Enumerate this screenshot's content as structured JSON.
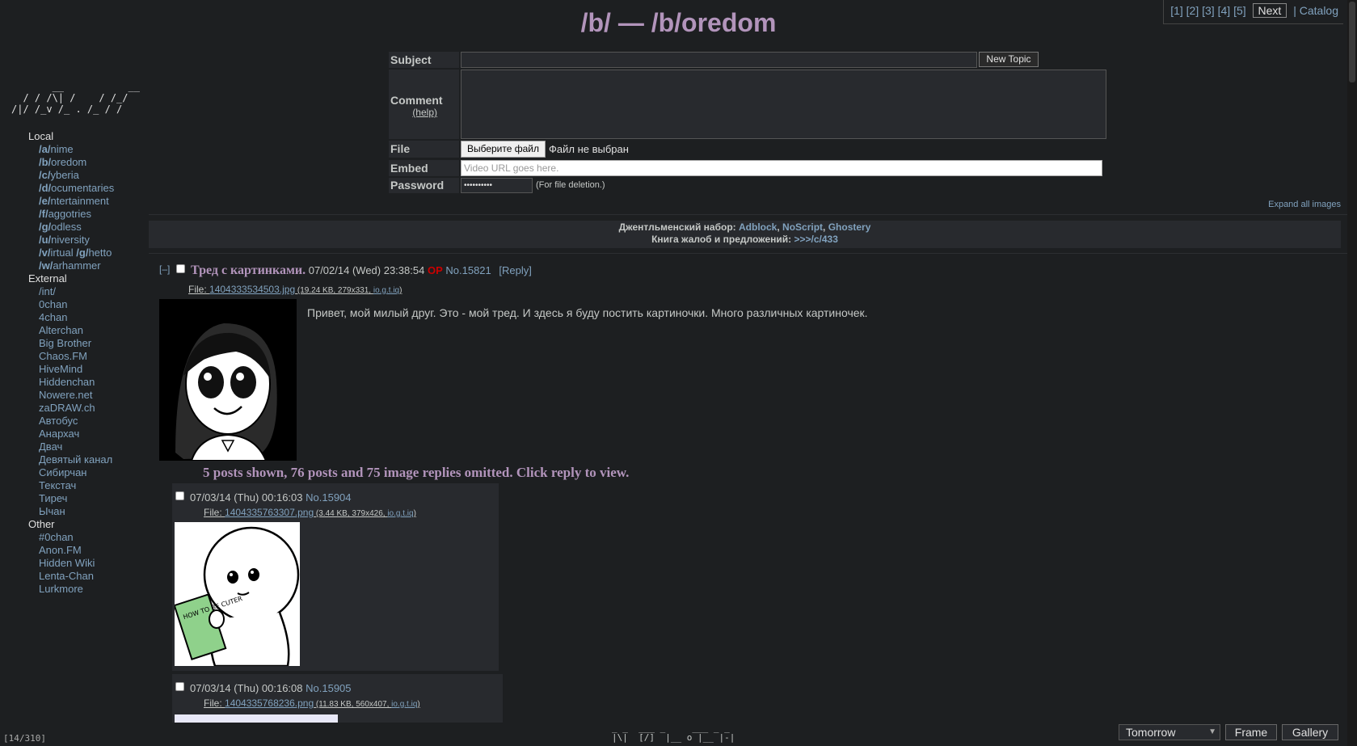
{
  "board_title": "/b/ — /b/oredom",
  "pager": {
    "pages": [
      "[1]",
      "[2]",
      "[3]",
      "[4]",
      "[5]"
    ],
    "next_label": "Next",
    "catalog_label": "| Catalog"
  },
  "sidebar": {
    "ascii_logo": "       __           __\n  / / /\\| /    / /_/\n/|/ /_v /_ . /_ / /",
    "sections": [
      {
        "label": "Local",
        "items": [
          {
            "bold": "/a/",
            "rest": "nime"
          },
          {
            "bold": "/b/",
            "rest": "oredom"
          },
          {
            "bold": "/c/",
            "rest": "yberia"
          },
          {
            "bold": "/d/",
            "rest": "ocumentaries"
          },
          {
            "bold": "/e/",
            "rest": "ntertainment"
          },
          {
            "bold": "/f/",
            "rest": "aggotries"
          },
          {
            "bold": "/g/",
            "rest": "odless"
          },
          {
            "bold": "/u/",
            "rest": "niversity"
          },
          {
            "bold": "/v/",
            "rest": "irtual ",
            "bold2": "/g/",
            "rest2": "hetto"
          },
          {
            "bold": "/w/",
            "rest": "arhammer"
          }
        ]
      },
      {
        "label": "External",
        "items": [
          {
            "rest": "/int/"
          },
          {
            "rest": "0chan"
          },
          {
            "rest": "4chan"
          },
          {
            "rest": "Alterchan"
          },
          {
            "rest": "Big Brother"
          },
          {
            "rest": "Chaos.FM"
          },
          {
            "rest": "HiveMind"
          },
          {
            "rest": "Hiddenchan"
          },
          {
            "rest": "Nowere.net"
          },
          {
            "rest": "zaDRAW.ch"
          },
          {
            "rest": "Автобус"
          },
          {
            "rest": "Анархач"
          },
          {
            "rest": "Двач"
          },
          {
            "rest": "Девятый канал"
          },
          {
            "rest": "Сибирчан"
          },
          {
            "rest": "Текстач"
          },
          {
            "rest": "Тиреч"
          },
          {
            "rest": "Ычан"
          }
        ]
      },
      {
        "label": "Other",
        "items": [
          {
            "rest": "#0chan"
          },
          {
            "rest": "Anon.FM"
          },
          {
            "rest": "Hidden Wiki"
          },
          {
            "rest": "Lenta-Chan"
          },
          {
            "rest": "Lurkmore"
          }
        ]
      }
    ]
  },
  "form": {
    "subject_label": "Subject",
    "new_topic_label": "New Topic",
    "comment_label": "Comment",
    "help_label": "(help)",
    "file_label": "File",
    "choose_file_label": "Выберите файл",
    "no_file_text": "Файл не выбран",
    "embed_label": "Embed",
    "embed_placeholder": "Video URL goes here.",
    "password_label": "Password",
    "password_value": "••••••••••",
    "password_note": "(For file deletion.)"
  },
  "expand_all": "Expand all images",
  "announce": {
    "line1_prefix": "Джентльменский набор: ",
    "line1_links": [
      "Adblock",
      "NoScript",
      "Ghostery"
    ],
    "line2_prefix": "Книга жалоб и предложений: ",
    "line2_link": ">>>/c/433"
  },
  "op": {
    "collapse": "[–]",
    "subject": "Тред с картинками.",
    "datetime": "07/02/14 (Wed) 23:38:54",
    "op_badge": "OP",
    "no": "No.15821",
    "reply": "[Reply]",
    "file_prefix": "File: ",
    "file_name": "1404333534503.jpg",
    "file_meta": " (19.24 KB, 279x331, ",
    "file_search": "io.g.t.iq",
    "file_close": ")",
    "message": "Привет, мой милый друг. Это - мой тред. И здесь я буду постить картиночки. Много различных картиночек."
  },
  "omitted": "5 posts shown, 76 posts and 75 image replies omitted. Click reply to view.",
  "replies": [
    {
      "datetime": "07/03/14 (Thu) 00:16:03",
      "no": "No.15904",
      "file_prefix": "File: ",
      "file_name": "1404335763307.png",
      "file_meta": " (3.44 KB, 379x426, ",
      "file_search": "io.g.t.iq",
      "file_close": ")",
      "book_text": "HOW TO BE CUTER"
    },
    {
      "datetime": "07/03/14 (Thu) 00:16:08",
      "no": "No.15905",
      "file_prefix": "File: ",
      "file_name": "1404335768236.png",
      "file_meta": " (11.83 KB, 560x407, ",
      "file_search": "io.g.t.iq",
      "file_close": ")"
    }
  ],
  "footer": {
    "counter": "[14/310]",
    "ascii": "_ _  ___ _     ___ _ _\n|\\|  [/]  |__ o |__ |-|",
    "style_select": "Tomorrow",
    "frame_label": "Frame",
    "gallery_label": "Gallery"
  },
  "colors": {
    "bg": "#1d1f21",
    "post_bg": "#282a2e",
    "link": "#81a2be",
    "title": "#b294bb",
    "op_red": "#cc0000"
  }
}
